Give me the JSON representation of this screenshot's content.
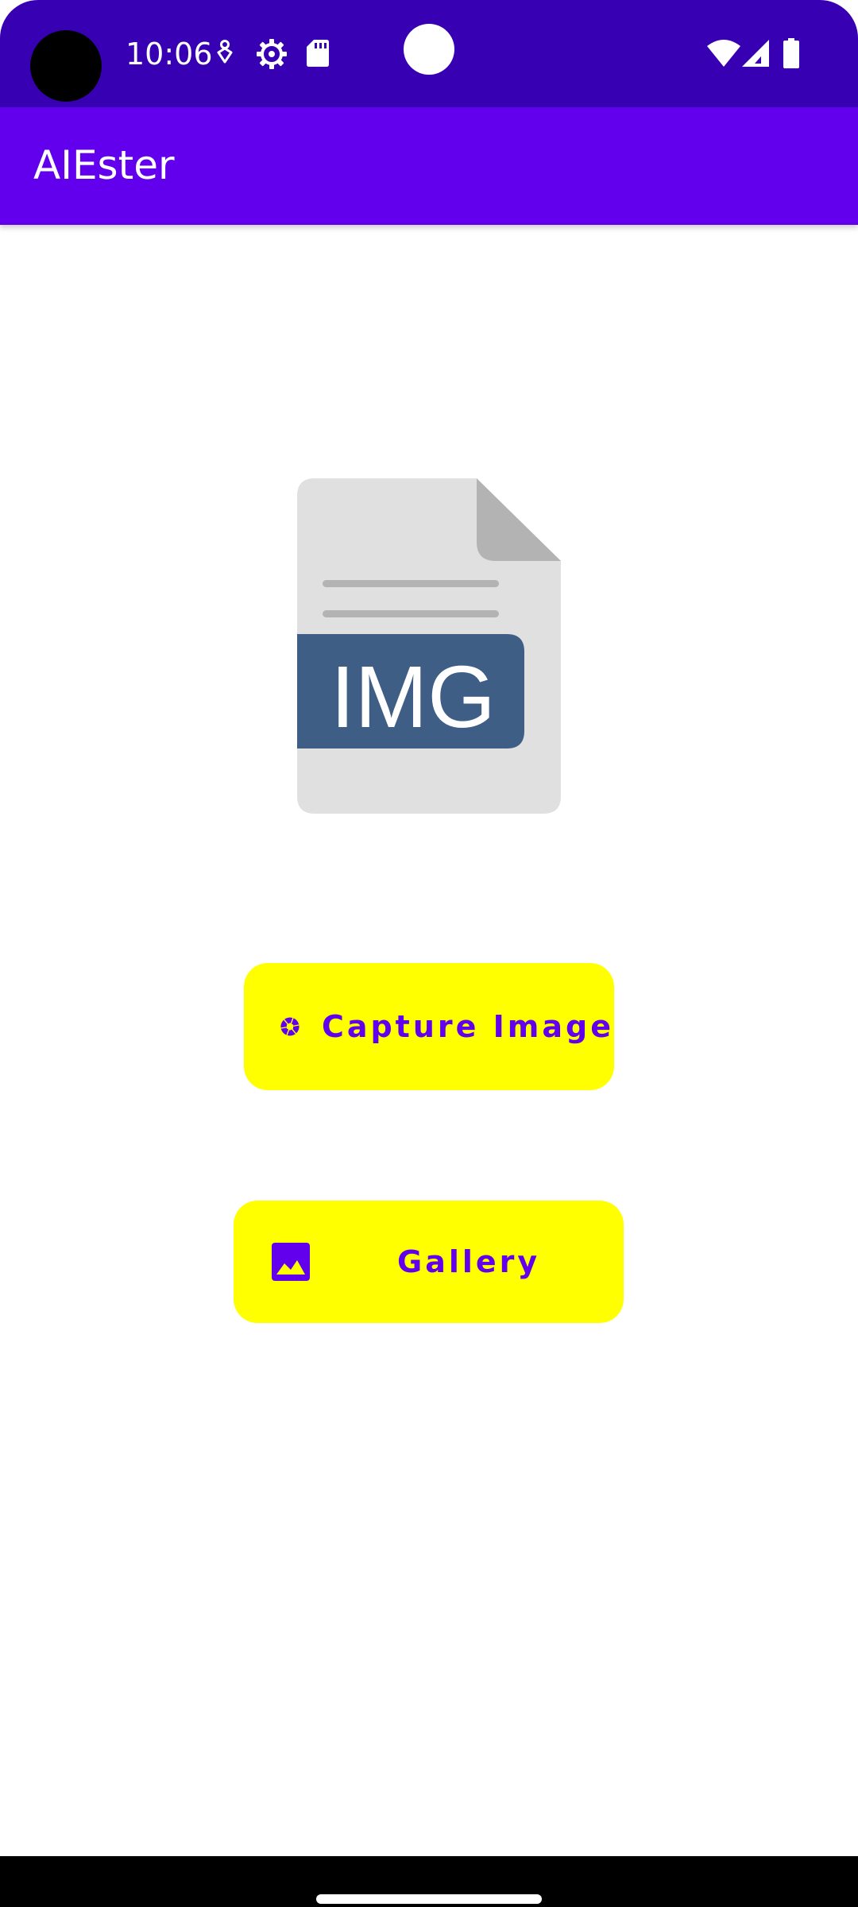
{
  "status_bar": {
    "time": "10:06",
    "background_color": "#3700b3",
    "icons": [
      "camera-hole",
      "location-icon",
      "settings-gear-icon",
      "sd-card-icon",
      "notification-dot",
      "wifi-icon",
      "signal-icon",
      "battery-icon"
    ]
  },
  "app_bar": {
    "title": "AIEster",
    "background_color": "#6200ee"
  },
  "illustration": {
    "label": "IMG",
    "icon": "image-file-icon"
  },
  "buttons": {
    "capture": {
      "label": "Capture Image",
      "icon": "camera-shutter-icon"
    },
    "gallery": {
      "label": "Gallery",
      "icon": "gallery-image-icon"
    },
    "background_color": "#ffff00",
    "text_color": "#6200ee"
  },
  "navigation": {
    "icon": "home-handle"
  }
}
